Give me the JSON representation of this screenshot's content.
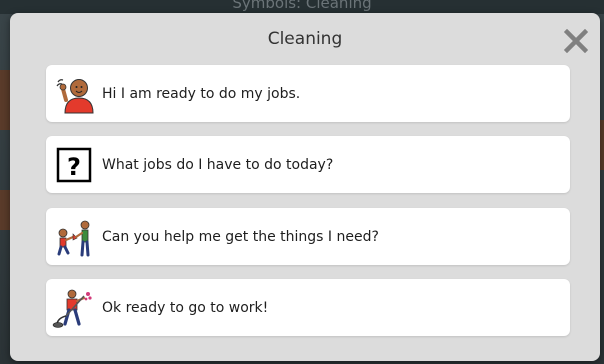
{
  "background": {
    "title": "Symbols: Cleaning"
  },
  "dialog": {
    "title": "Cleaning",
    "close_icon": "close-icon",
    "phrases": [
      {
        "label": "Hi I am ready to do my jobs.",
        "icon": "waving-person-icon"
      },
      {
        "label": "What jobs do I have to do today?",
        "icon": "question-mark-icon"
      },
      {
        "label": "Can you help me get the things I need?",
        "icon": "giving-help-icon"
      },
      {
        "label": "Ok ready to go to work!",
        "icon": "vacuuming-person-icon"
      }
    ]
  },
  "colors": {
    "modal_bg": "#dcdcdc",
    "card_bg": "#ffffff",
    "close_icon": "#808080"
  }
}
